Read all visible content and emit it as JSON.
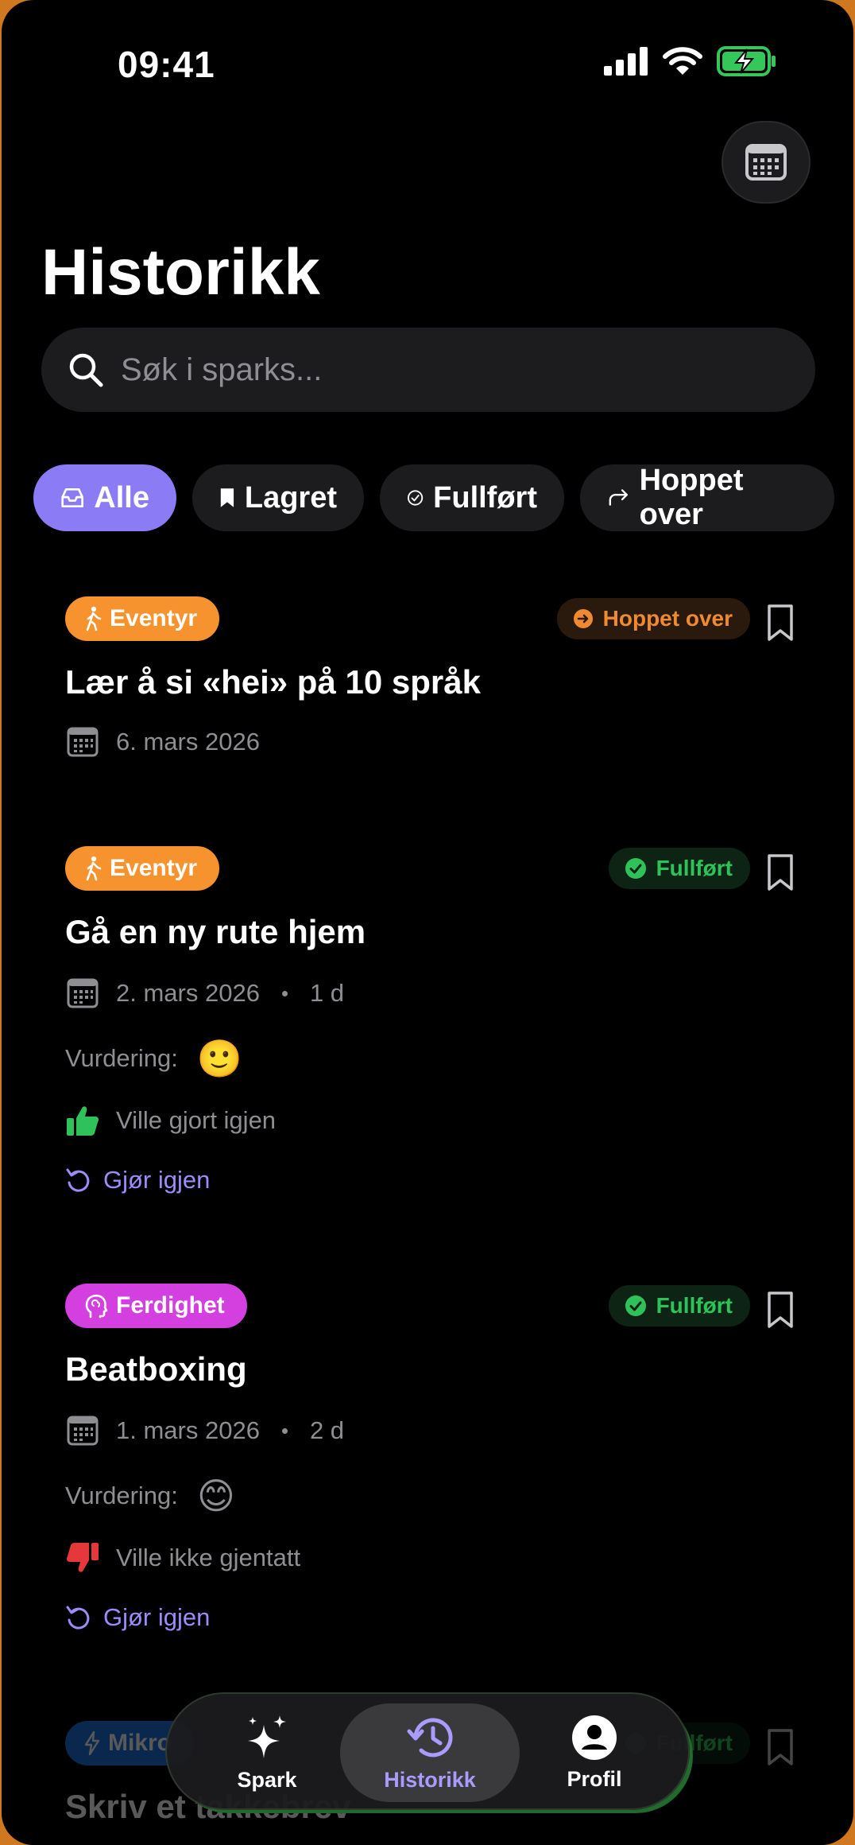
{
  "status_bar": {
    "time": "09:41"
  },
  "page_title": "Historikk",
  "search": {
    "placeholder": "Søk i sparks..."
  },
  "filters": [
    {
      "label": "Alle",
      "icon": "tray-icon",
      "active": true
    },
    {
      "label": "Lagret",
      "icon": "bookmark-icon",
      "active": false
    },
    {
      "label": "Fullført",
      "icon": "check-circle-icon",
      "active": false
    },
    {
      "label": "Hoppet over",
      "icon": "skip-arrow-icon",
      "active": false
    }
  ],
  "cards": [
    {
      "category": "Eventyr",
      "category_color": "#f7932e",
      "status": "Hoppet over",
      "title": "Lær å si «hei» på 10 språk",
      "date": "6. mars 2026"
    },
    {
      "category": "Eventyr",
      "category_color": "#f7932e",
      "status": "Fullført",
      "title": "Gå en ny rute hjem",
      "date": "2. mars 2026",
      "duration": "1 d",
      "rating_label": "Vurdering:",
      "rating_emoji": "🙂",
      "again": "Ville gjort igjen",
      "redo": "Gjør igjen"
    },
    {
      "category": "Ferdighet",
      "category_color": "#d43fe0",
      "status": "Fullført",
      "title": "Beatboxing",
      "date": "1. mars 2026",
      "duration": "2 d",
      "rating_label": "Vurdering:",
      "rating_emoji": "😊",
      "again": "Ville ikke gjentatt",
      "redo": "Gjør igjen"
    },
    {
      "category": "Mikro",
      "category_color": "#1d6fe0",
      "status": "Fullført",
      "title": "Skriv et takkebrev"
    }
  ],
  "tabbar": [
    {
      "label": "Spark",
      "icon": "sparkles-icon",
      "active": false
    },
    {
      "label": "Historikk",
      "icon": "history-icon",
      "active": true
    },
    {
      "label": "Profil",
      "icon": "person-icon",
      "active": false
    }
  ],
  "colors": {
    "accent": "#8b7cf6",
    "skipped": "#f08a30",
    "done": "#2fc25a",
    "thumb_up": "#2fc25a",
    "thumb_down": "#e5383b"
  }
}
